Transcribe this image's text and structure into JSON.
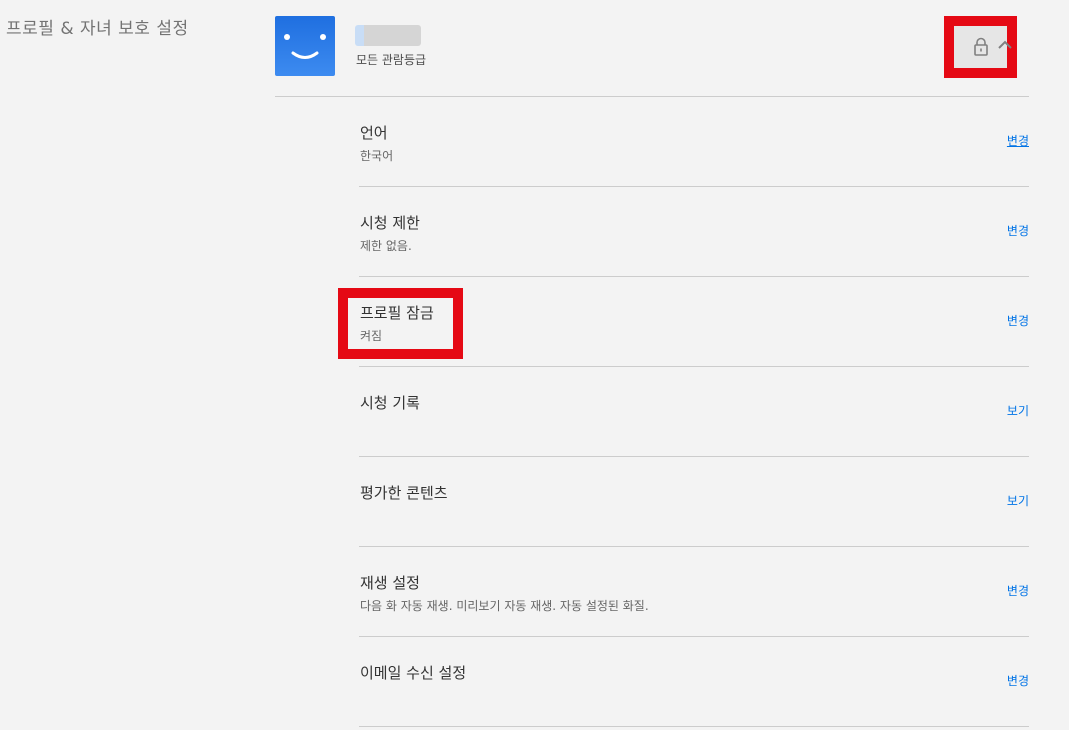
{
  "section": {
    "title": "프로필 & 자녀 보호 설정"
  },
  "profile": {
    "name": "",
    "rating": "모든 관람등급"
  },
  "settings": [
    {
      "title": "언어",
      "desc": "한국어",
      "action": "변경"
    },
    {
      "title": "시청 제한",
      "desc": "제한 없음.",
      "action": "변경"
    },
    {
      "title": "프로필 잠금",
      "desc": "켜짐",
      "action": "변경"
    },
    {
      "title": "시청 기록",
      "desc": "",
      "action": "보기"
    },
    {
      "title": "평가한 콘텐츠",
      "desc": "",
      "action": "보기"
    },
    {
      "title": "재생 설정",
      "desc": "다음 화 자동 재생. 미리보기 자동 재생. 자동 설정된 화질.",
      "action": "변경"
    },
    {
      "title": "이메일 수신 설정",
      "desc": "",
      "action": "변경"
    }
  ],
  "colors": {
    "background": "#f3f3f3",
    "highlight": "#e50914",
    "link": "#0073e6",
    "avatar": "#2b7de9"
  },
  "icons": {
    "avatar": "smiley-face-icon",
    "lock": "lock-icon",
    "chevron": "chevron-up-icon"
  }
}
